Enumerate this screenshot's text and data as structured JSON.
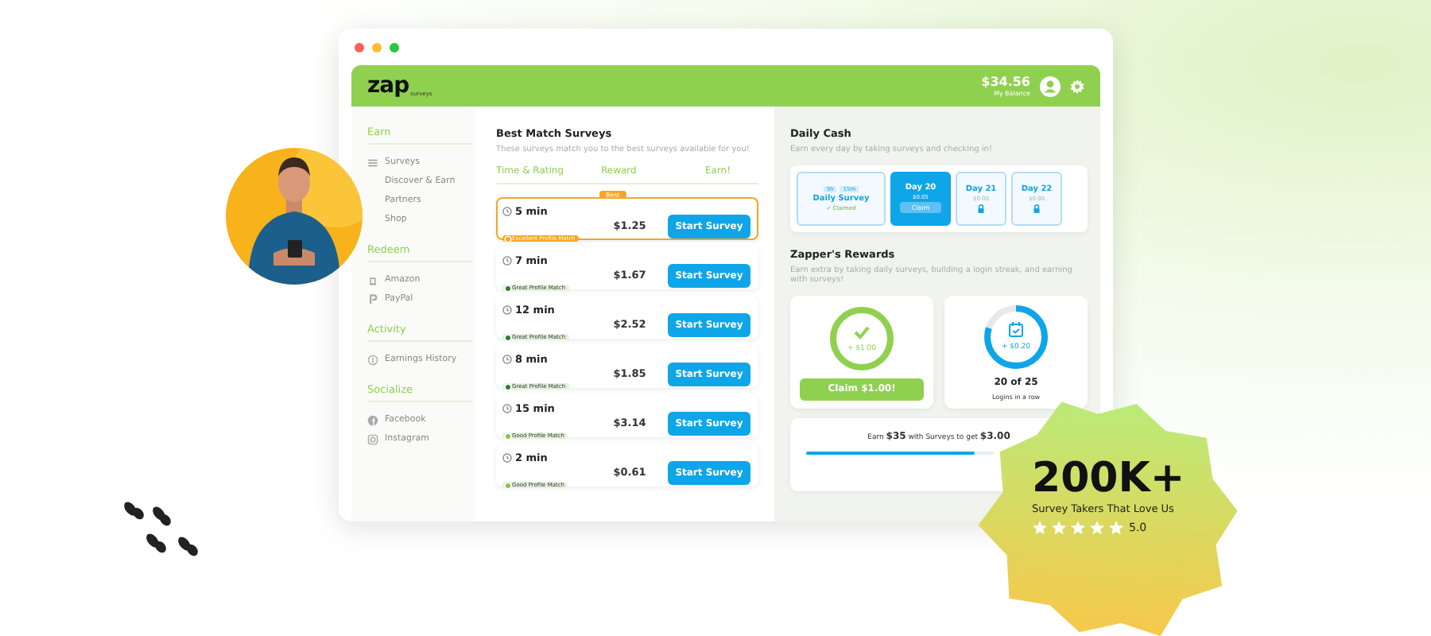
{
  "header": {
    "logo": "zap",
    "logo_sub": "surveys",
    "balance": "$34.56",
    "balance_label": "My Balance"
  },
  "sidebar": {
    "sections": [
      {
        "title": "Earn",
        "items": [
          {
            "label": "Surveys"
          },
          {
            "label": "Discover & Earn"
          },
          {
            "label": "Partners"
          },
          {
            "label": "Shop"
          }
        ]
      },
      {
        "title": "Redeem",
        "items": [
          {
            "label": "Amazon"
          },
          {
            "label": "PayPal"
          }
        ]
      },
      {
        "title": "Activity",
        "items": [
          {
            "label": "Earnings History"
          }
        ]
      },
      {
        "title": "Socialize",
        "items": [
          {
            "label": "Facebook"
          },
          {
            "label": "Instagram"
          }
        ]
      }
    ]
  },
  "surveys": {
    "title": "Best Match Surveys",
    "subtitle": "These surveys match you to the best surveys available for you!",
    "columns": [
      "Time & Rating",
      "Reward",
      "Earn!"
    ],
    "rows": [
      {
        "time": "5 min",
        "match": "Excellent Profile Match",
        "color": "#f5a623",
        "reward": "$1.25",
        "button": "Start Survey",
        "badge": "Best",
        "selected": true
      },
      {
        "time": "7 min",
        "match": "Great Profile Match",
        "color": "#2e7d32",
        "reward": "$1.67",
        "button": "Start Survey",
        "selected": false
      },
      {
        "time": "12 min",
        "match": "Great Profile Match",
        "color": "#2e7d32",
        "reward": "$2.52",
        "button": "Start Survey",
        "selected": false
      },
      {
        "time": "8 min",
        "match": "Great Profile Match",
        "color": "#2e7d32",
        "reward": "$1.85",
        "button": "Start Survey",
        "selected": false
      },
      {
        "time": "15 min",
        "match": "Good Profile Match",
        "color": "#8bc34a",
        "reward": "$3.14",
        "button": "Start Survey",
        "selected": false
      },
      {
        "time": "2 min",
        "match": "Good Profile Match",
        "color": "#8bc34a",
        "reward": "$0.61",
        "button": "Start Survey",
        "selected": false
      }
    ]
  },
  "daily_cash": {
    "title": "Daily Cash",
    "subtitle": "Earn every day by taking surveys and checking in!",
    "days": [
      {
        "kind": "survey",
        "timer": [
          "5h",
          "15m"
        ],
        "label": "Daily Survey",
        "status": "✓ Claimed"
      },
      {
        "kind": "current",
        "label": "Day 20",
        "amount": "$0.05",
        "button": "Claim"
      },
      {
        "kind": "locked",
        "label": "Day 21",
        "amount": "$0.00"
      },
      {
        "kind": "locked",
        "label": "Day 22",
        "amount": "$0.00"
      }
    ]
  },
  "rewards": {
    "title": "Zapper's Rewards",
    "subtitle": "Earn extra by taking daily surveys, building a login streak, and earning with surveys!",
    "claim": {
      "amount": "+ $1.00",
      "level": 1,
      "button": "Claim $1.00!"
    },
    "streak": {
      "amount": "+ $0.20",
      "level": 0.8,
      "count": "20 of 25",
      "caption": "Logins in a row"
    },
    "goal": {
      "text": "Earn **$35** with Surveys to get **$3.00**",
      "level": 0.9
    }
  },
  "badge": {
    "value": "200K+",
    "caption": "Survey Takers That Love Us",
    "stars": 5,
    "rating": "5.0"
  }
}
